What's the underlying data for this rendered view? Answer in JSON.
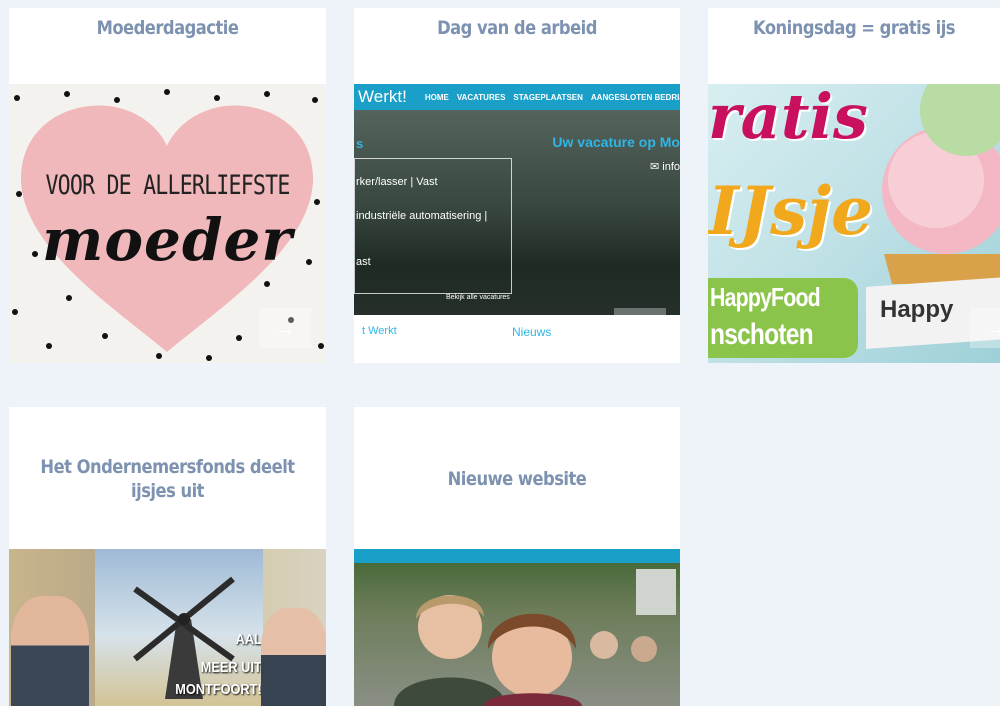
{
  "cards": [
    {
      "title": "Moederdagactie",
      "image": {
        "line1": "VOOR DE ALLERLIEFSTE",
        "line2": "moeder"
      },
      "arrow": "→"
    },
    {
      "title": "Dag van de arbeid",
      "image": {
        "logo": "Werkt!",
        "nav": [
          "HOME",
          "VACATURES",
          "STAGEPLAATSEN",
          "AANGESLOTEN BEDRIJ"
        ],
        "hero_title": "Uw vacature op Mo",
        "info": "✉ info",
        "heading_s": "s",
        "jobs": [
          "rker/lasser | Vast",
          "industriële automatisering |",
          "ast"
        ],
        "link": "Bekijk alle vacatures",
        "footer_left": "t Werkt",
        "footer_right": "Nieuws"
      },
      "arrow": "→"
    },
    {
      "title": "Koningsdag = gratis ijs",
      "image": {
        "word1": "ratis",
        "word2": "IJsje",
        "brand1": "HappyFood",
        "brand2": "nschoten",
        "brand3": "Happy"
      },
      "arrow": "→"
    },
    {
      "title": "Het Ondernemersfonds deelt ijsjes uit",
      "image": {
        "line1": "AAL",
        "line2": "MEER UIT",
        "line3": "MONTFOORT!"
      }
    },
    {
      "title": "Nieuwe website",
      "image": {}
    }
  ],
  "colors": {
    "page_bg": "#eef3fa",
    "title": "#7d92b0",
    "heart": "#f0b8ba",
    "accent_blue": "#1a9fc9",
    "ice_pink": "#c8105e",
    "ice_green": "#8bc44a"
  },
  "icons": {
    "arrow": "arrow-right-icon",
    "envelope": "envelope-icon"
  }
}
